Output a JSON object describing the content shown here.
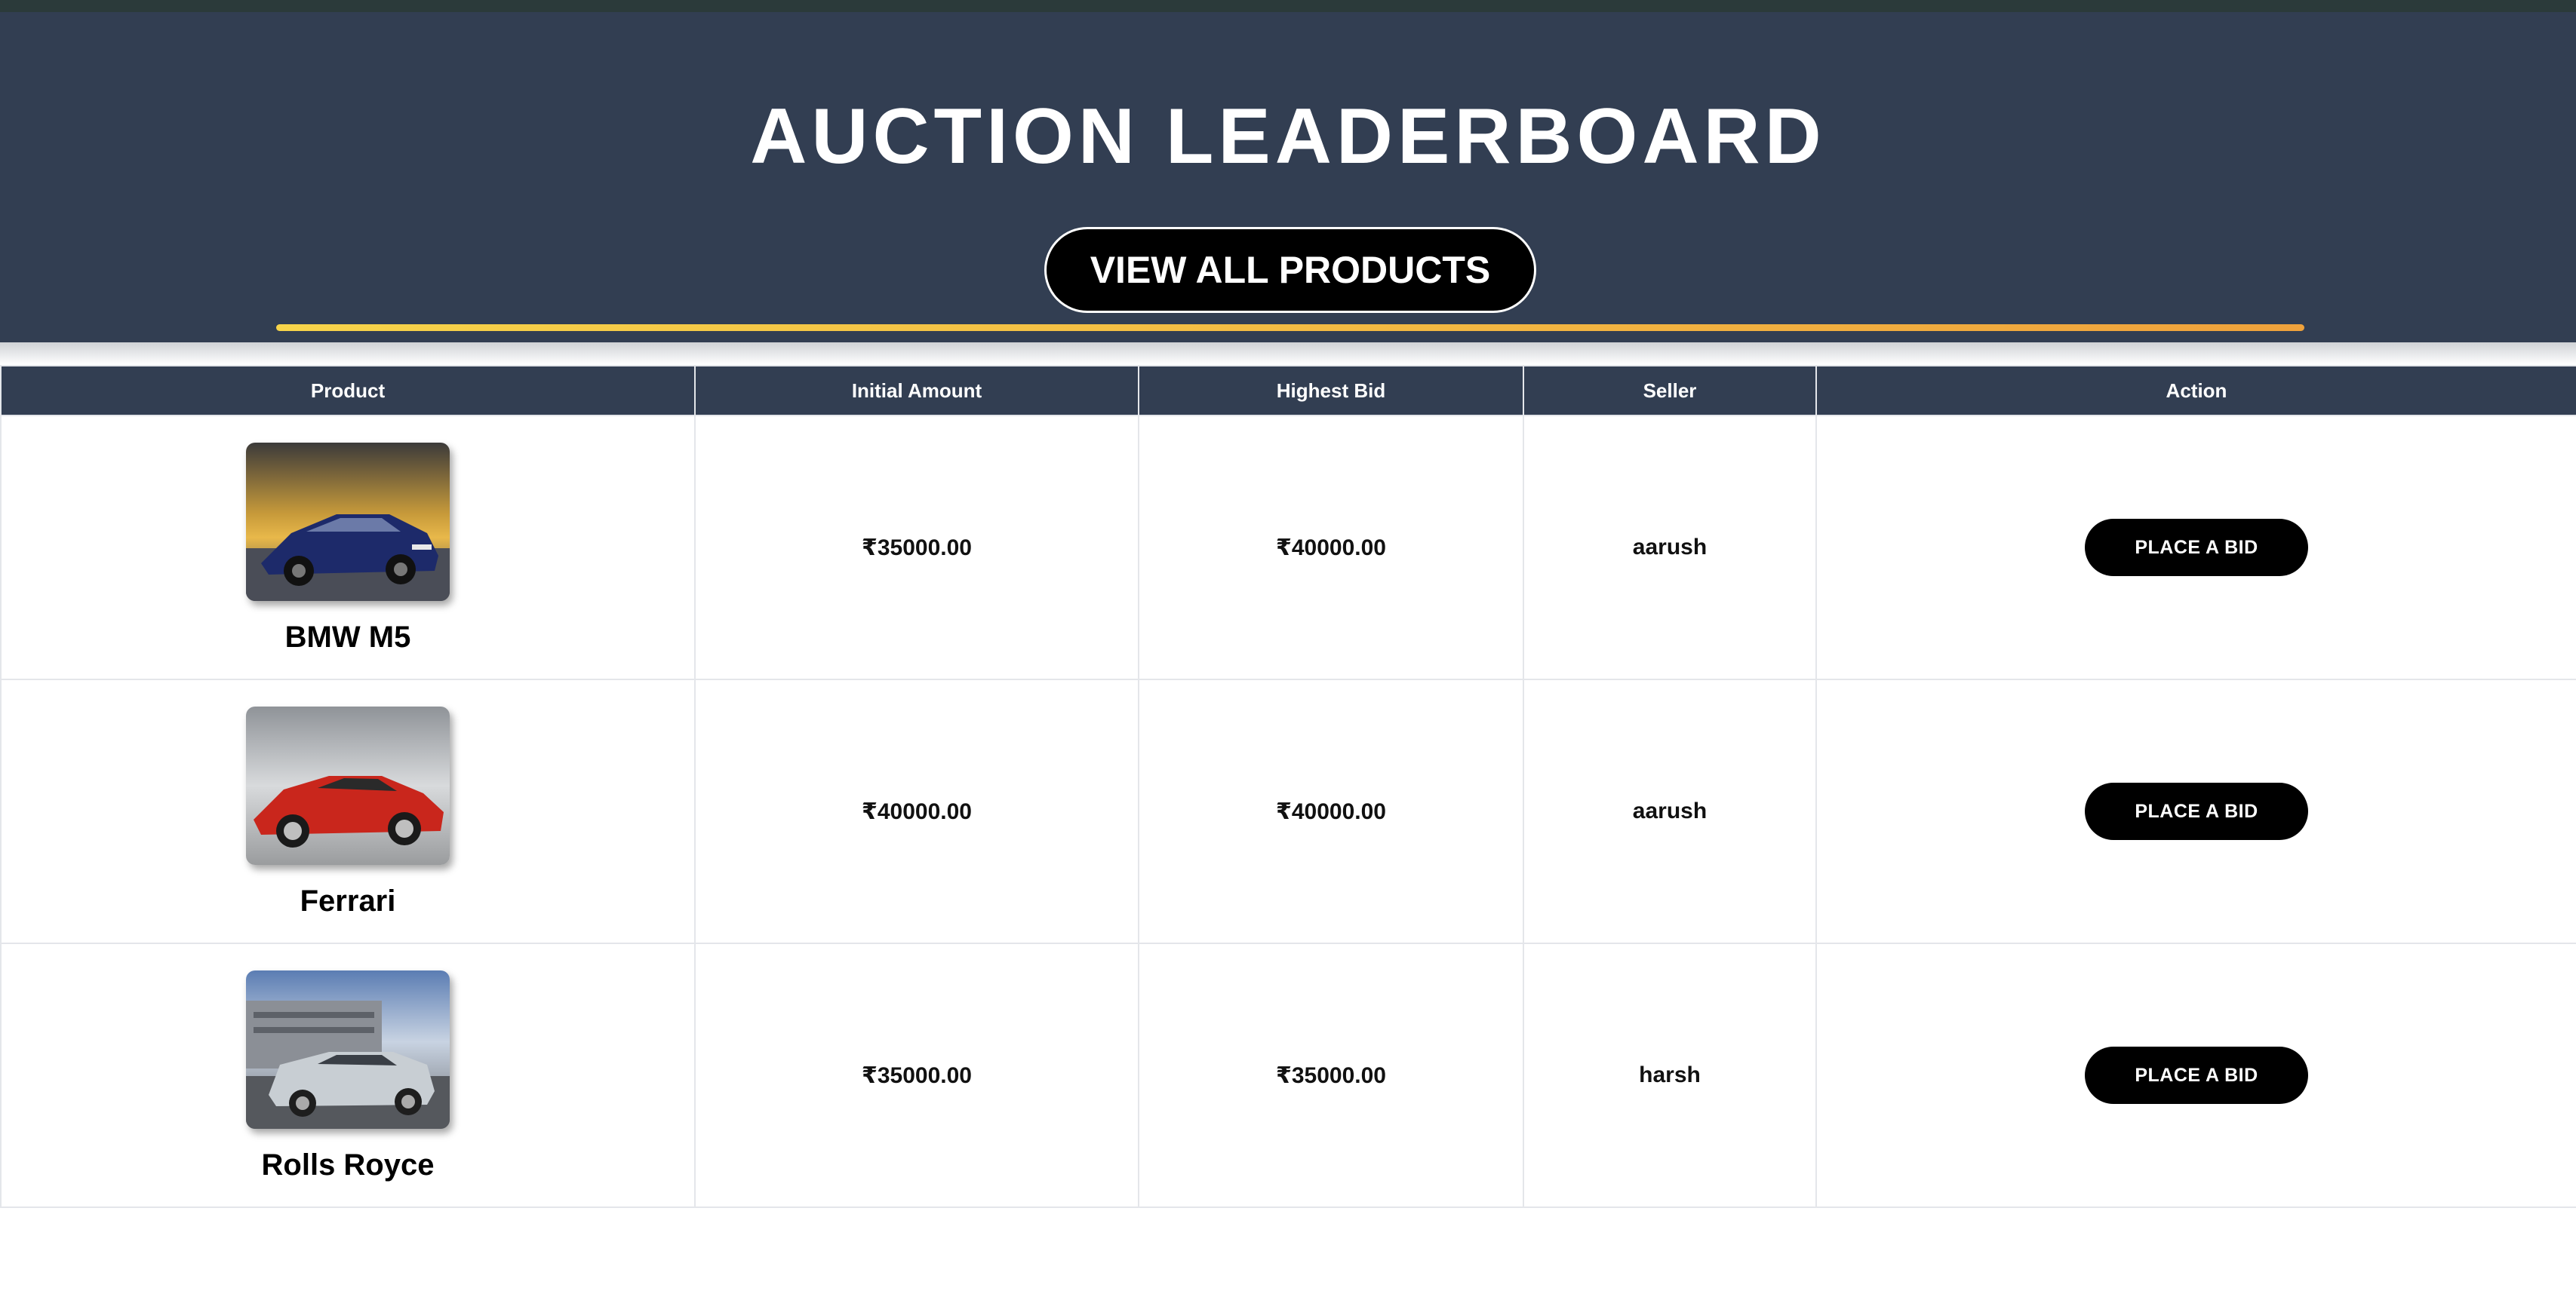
{
  "header": {
    "title": "AUCTION LEADERBOARD",
    "view_all_label": "VIEW ALL PRODUCTS",
    "accent_colors": [
      "#f7d44a",
      "#efa23c"
    ]
  },
  "table": {
    "columns": [
      "Product",
      "Initial Amount",
      "Highest Bid",
      "Seller",
      "Action"
    ],
    "rows": [
      {
        "product": "BMW M5",
        "image_icon": "blue-sedan-image",
        "initial_amount": "₹35000.00",
        "highest_bid": "₹40000.00",
        "seller": "aarush",
        "action_label": "PLACE A BID"
      },
      {
        "product": "Ferrari",
        "image_icon": "red-sportscar-image",
        "initial_amount": "₹40000.00",
        "highest_bid": "₹40000.00",
        "seller": "aarush",
        "action_label": "PLACE A BID"
      },
      {
        "product": "Rolls Royce",
        "image_icon": "silver-luxury-car-image",
        "initial_amount": "₹35000.00",
        "highest_bid": "₹35000.00",
        "seller": "harsh",
        "action_label": "PLACE A BID"
      }
    ]
  },
  "colors": {
    "header_bg": "#323e52",
    "button_bg": "#000000",
    "text_light": "#ffffff"
  }
}
